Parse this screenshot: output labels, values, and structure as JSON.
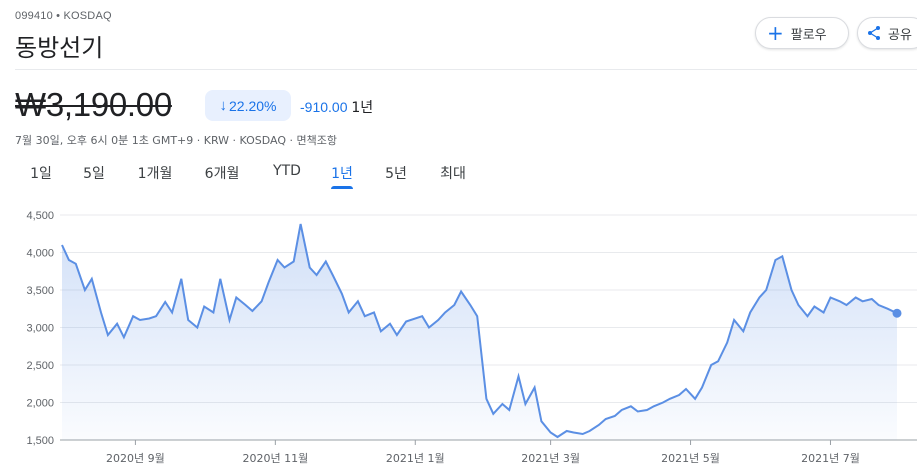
{
  "header": {
    "ticker": "099410 • KOSDAQ",
    "name": "동방선기",
    "follow_label": "팔로우",
    "share_label": "공유"
  },
  "icons": {
    "follow": "plus-icon",
    "share": "share-icon",
    "change": "arrow-down-icon"
  },
  "colors": {
    "accent": "#1a73e8",
    "line": "#5b8fe4",
    "fill": "#e8f0fe"
  },
  "quote": {
    "price": "₩3,190.00",
    "percent": "22.20%",
    "change": "-910.00",
    "period": "1년",
    "meta": "7월 30일, 오후 6시 0분 1초 GMT+9 · KRW · KOSDAQ · 면책조항"
  },
  "tabs": [
    {
      "label": "1일",
      "active": false
    },
    {
      "label": "5일",
      "active": false
    },
    {
      "label": "1개월",
      "active": false
    },
    {
      "label": "6개월",
      "active": false
    },
    {
      "label": "YTD",
      "active": false
    },
    {
      "label": "1년",
      "active": true
    },
    {
      "label": "5년",
      "active": false
    },
    {
      "label": "최대",
      "active": false
    }
  ],
  "chart_data": {
    "type": "area",
    "title": "",
    "xlabel": "",
    "ylabel": "",
    "ylim": [
      1500,
      4500
    ],
    "yticks": [
      1500,
      2000,
      2500,
      3000,
      3500,
      4000,
      4500
    ],
    "yticklabels": [
      "1,500",
      "2,000",
      "2,500",
      "3,000",
      "3,500",
      "4,000",
      "4,500"
    ],
    "x_ticks": [
      {
        "label": "2020년 9월",
        "date": "2020-09-01"
      },
      {
        "label": "2020년 11월",
        "date": "2020-11-01"
      },
      {
        "label": "2021년 1월",
        "date": "2021-01-01"
      },
      {
        "label": "2021년 3월",
        "date": "2021-03-01"
      },
      {
        "label": "2021년 5월",
        "date": "2021-05-01"
      },
      {
        "label": "2021년 7월",
        "date": "2021-07-01"
      }
    ],
    "grid": true,
    "legend": "none",
    "series": [
      {
        "points": [
          [
            "2020-07-31",
            4100
          ],
          [
            "2020-08-03",
            3900
          ],
          [
            "2020-08-06",
            3850
          ],
          [
            "2020-08-10",
            3500
          ],
          [
            "2020-08-13",
            3650
          ],
          [
            "2020-08-17",
            3200
          ],
          [
            "2020-08-20",
            2900
          ],
          [
            "2020-08-24",
            3050
          ],
          [
            "2020-08-27",
            2870
          ],
          [
            "2020-08-31",
            3150
          ],
          [
            "2020-09-03",
            3100
          ],
          [
            "2020-09-07",
            3120
          ],
          [
            "2020-09-10",
            3150
          ],
          [
            "2020-09-14",
            3340
          ],
          [
            "2020-09-17",
            3200
          ],
          [
            "2020-09-21",
            3650
          ],
          [
            "2020-09-24",
            3100
          ],
          [
            "2020-09-28",
            3000
          ],
          [
            "2020-10-01",
            3280
          ],
          [
            "2020-10-05",
            3200
          ],
          [
            "2020-10-08",
            3650
          ],
          [
            "2020-10-12",
            3100
          ],
          [
            "2020-10-15",
            3400
          ],
          [
            "2020-10-19",
            3300
          ],
          [
            "2020-10-22",
            3220
          ],
          [
            "2020-10-26",
            3350
          ],
          [
            "2020-10-29",
            3600
          ],
          [
            "2020-11-02",
            3900
          ],
          [
            "2020-11-05",
            3800
          ],
          [
            "2020-11-09",
            3880
          ],
          [
            "2020-11-12",
            4380
          ],
          [
            "2020-11-16",
            3800
          ],
          [
            "2020-11-19",
            3700
          ],
          [
            "2020-11-23",
            3880
          ],
          [
            "2020-11-26",
            3700
          ],
          [
            "2020-11-30",
            3450
          ],
          [
            "2020-12-03",
            3200
          ],
          [
            "2020-12-07",
            3350
          ],
          [
            "2020-12-10",
            3150
          ],
          [
            "2020-12-14",
            3200
          ],
          [
            "2020-12-17",
            2950
          ],
          [
            "2020-12-21",
            3050
          ],
          [
            "2020-12-24",
            2900
          ],
          [
            "2020-12-28",
            3080
          ],
          [
            "2021-01-04",
            3150
          ],
          [
            "2021-01-07",
            3000
          ],
          [
            "2021-01-11",
            3100
          ],
          [
            "2021-01-14",
            3200
          ],
          [
            "2021-01-18",
            3300
          ],
          [
            "2021-01-21",
            3480
          ],
          [
            "2021-01-25",
            3300
          ],
          [
            "2021-01-28",
            3150
          ],
          [
            "2021-02-01",
            2050
          ],
          [
            "2021-02-04",
            1850
          ],
          [
            "2021-02-08",
            1980
          ],
          [
            "2021-02-11",
            1900
          ],
          [
            "2021-02-15",
            2350
          ],
          [
            "2021-02-18",
            1980
          ],
          [
            "2021-02-22",
            2200
          ],
          [
            "2021-02-25",
            1750
          ],
          [
            "2021-03-01",
            1600
          ],
          [
            "2021-03-04",
            1540
          ],
          [
            "2021-03-08",
            1620
          ],
          [
            "2021-03-11",
            1600
          ],
          [
            "2021-03-15",
            1580
          ],
          [
            "2021-03-18",
            1620
          ],
          [
            "2021-03-22",
            1700
          ],
          [
            "2021-03-25",
            1780
          ],
          [
            "2021-03-29",
            1820
          ],
          [
            "2021-04-01",
            1900
          ],
          [
            "2021-04-05",
            1950
          ],
          [
            "2021-04-08",
            1880
          ],
          [
            "2021-04-12",
            1900
          ],
          [
            "2021-04-15",
            1950
          ],
          [
            "2021-04-19",
            2000
          ],
          [
            "2021-04-22",
            2050
          ],
          [
            "2021-04-26",
            2100
          ],
          [
            "2021-04-29",
            2180
          ],
          [
            "2021-05-03",
            2050
          ],
          [
            "2021-05-06",
            2200
          ],
          [
            "2021-05-10",
            2500
          ],
          [
            "2021-05-13",
            2550
          ],
          [
            "2021-05-17",
            2800
          ],
          [
            "2021-05-20",
            3100
          ],
          [
            "2021-05-24",
            2950
          ],
          [
            "2021-05-27",
            3200
          ],
          [
            "2021-05-31",
            3400
          ],
          [
            "2021-06-03",
            3500
          ],
          [
            "2021-06-07",
            3900
          ],
          [
            "2021-06-10",
            3950
          ],
          [
            "2021-06-14",
            3500
          ],
          [
            "2021-06-17",
            3300
          ],
          [
            "2021-06-21",
            3150
          ],
          [
            "2021-06-24",
            3280
          ],
          [
            "2021-06-28",
            3200
          ],
          [
            "2021-07-01",
            3400
          ],
          [
            "2021-07-05",
            3350
          ],
          [
            "2021-07-08",
            3300
          ],
          [
            "2021-07-12",
            3400
          ],
          [
            "2021-07-15",
            3350
          ],
          [
            "2021-07-19",
            3380
          ],
          [
            "2021-07-22",
            3300
          ],
          [
            "2021-07-26",
            3250
          ],
          [
            "2021-07-30",
            3190
          ]
        ]
      }
    ]
  }
}
